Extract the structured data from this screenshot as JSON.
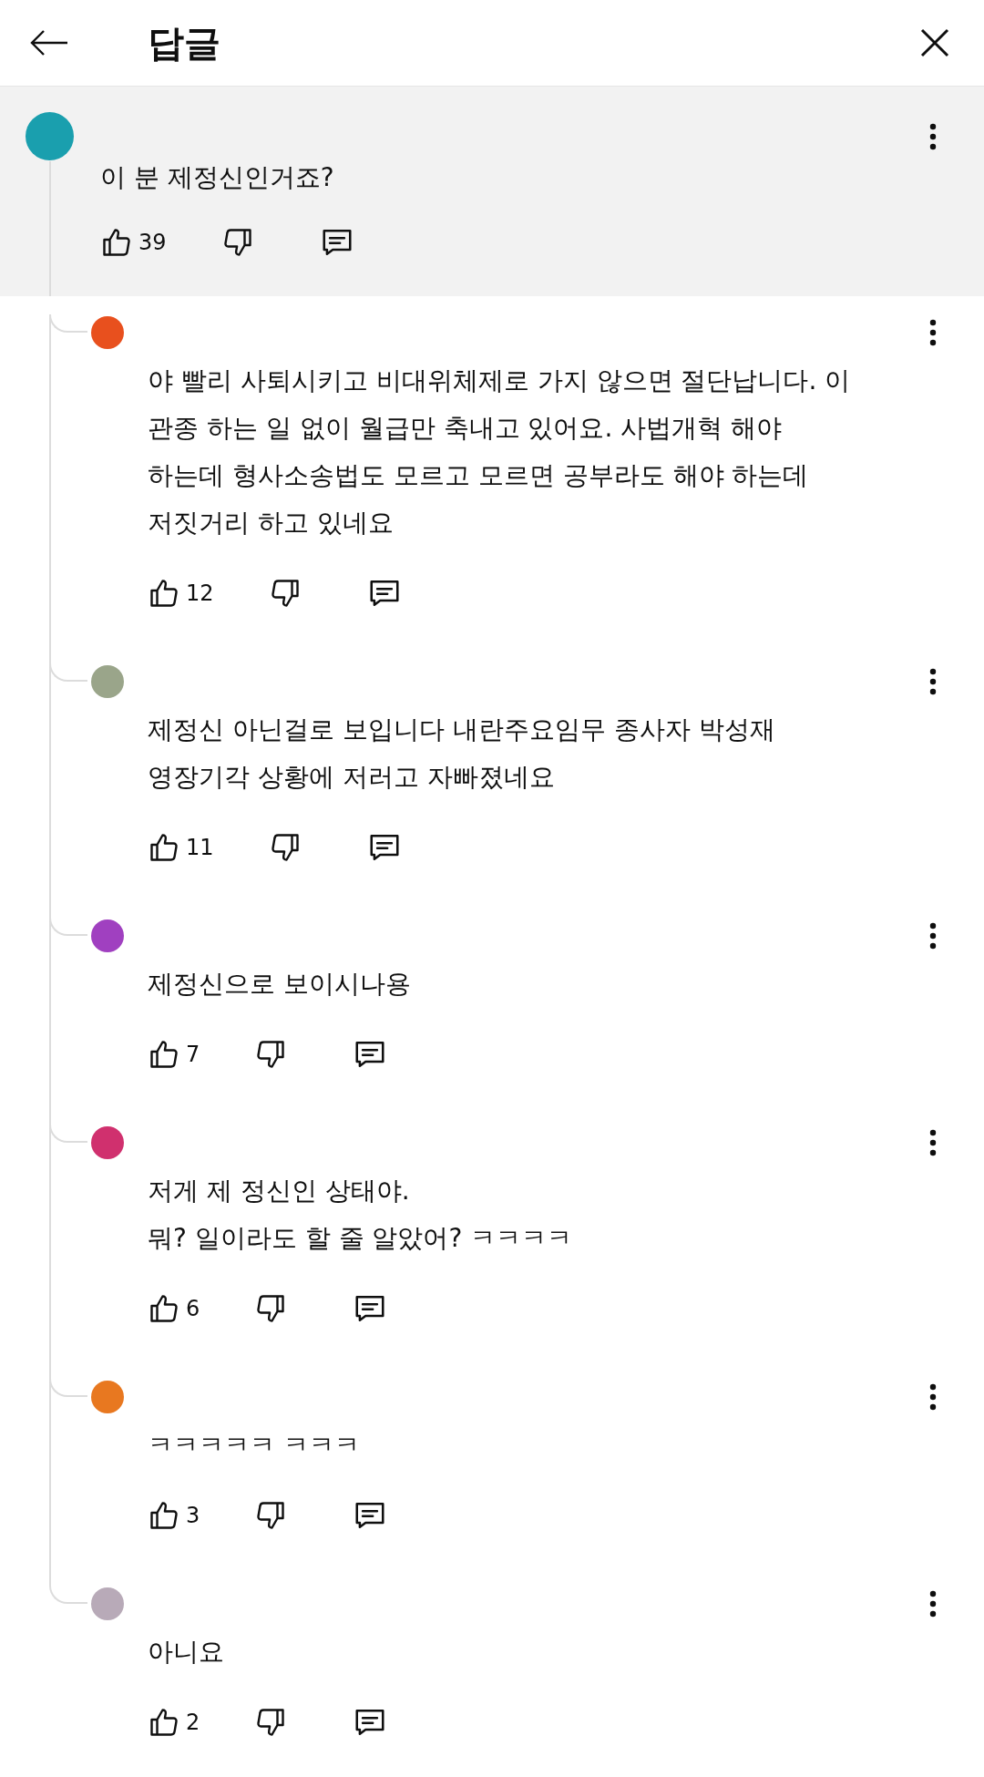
{
  "header": {
    "title": "답글"
  },
  "comment": {
    "color": "#1a9fae",
    "lines": [
      "이 분 제정신인거죠?"
    ],
    "likes": "39"
  },
  "replies": [
    {
      "color": "#e8501e",
      "lines": [
        "야 빨리 사퇴시키고 비대위체제로 가지 않으면 절단납니다. 이",
        "관종 하는 일 없이 월급만 축내고 있어요. 사법개혁 해야",
        "하는데 형사소송법도 모르고 모르면 공부라도 해야 하는데",
        "저짓거리 하고 있네요"
      ],
      "likes": "12"
    },
    {
      "color": "#9aa58a",
      "lines": [
        "제정신 아닌걸로 보입니다 내란주요임무 종사자 박성재",
        "영장기각 상황에 저러고 자빠졌네요"
      ],
      "likes": "11"
    },
    {
      "color": "#a040c0",
      "lines": [
        "제정신으로 보이시나용"
      ],
      "likes": "7"
    },
    {
      "color": "#d0306e",
      "lines": [
        "저게 제 정신인 상태야.",
        "뭐? 일이라도 할 줄 알았어? ㅋㅋㅋㅋ"
      ],
      "likes": "6"
    },
    {
      "color": "#e87820",
      "lines": [
        "ㅋㅋㅋㅋㅋ ㅋㅋㅋ"
      ],
      "likes": "3"
    },
    {
      "color": "#b8aab8",
      "lines": [
        "아니요"
      ],
      "likes": "2"
    }
  ]
}
